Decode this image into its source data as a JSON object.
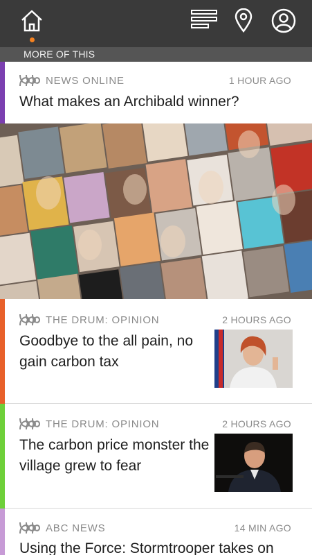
{
  "topbar": {
    "icons": [
      "home-icon",
      "menu-lines-icon",
      "location-pin-icon",
      "profile-icon"
    ],
    "active_dot_color": "#f58220"
  },
  "section": {
    "label": "MORE OF THIS"
  },
  "stories": [
    {
      "source": "NEWS ONLINE",
      "time": "1 HOUR AGO",
      "headline": "What makes an Archibald winner?",
      "accent": "#7b3fb0",
      "image": "archibald-portraits-collage"
    },
    {
      "source": "THE DRUM: OPINION",
      "time": "2 HOURS AGO",
      "headline": "Goodbye to the all pain, no gain carbon tax",
      "accent": "#e8602a",
      "image": "woman-speaking-thumbnail"
    },
    {
      "source": "THE DRUM: OPINION",
      "time": "2 HOURS AGO",
      "headline": "The carbon price monster the village grew to fear",
      "accent": "#6ed03a",
      "image": "man-speaking-thumbnail"
    },
    {
      "source": "ABC NEWS",
      "time": "14 MIN AGO",
      "headline": "Using the Force: Stormtrooper takes on",
      "accent": "#c79bd6",
      "image": ""
    }
  ]
}
